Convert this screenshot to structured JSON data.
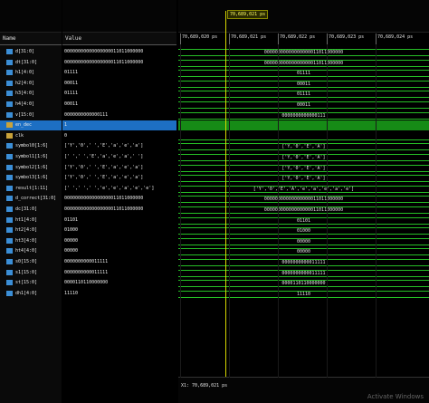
{
  "headers": {
    "name": "Name",
    "value": "Value"
  },
  "cursor": {
    "label": "70,689,021 ps"
  },
  "ruler": [
    "70,689,020 ps",
    "70,689,021 ps",
    "70,689,022 ps",
    "70,689,023 ps",
    "70,689,024 ps"
  ],
  "signals": [
    {
      "name": "d[31:0]",
      "value": "00000000000000000011011000000",
      "wave": "00000000000000000011011000000"
    },
    {
      "name": "dt[31:0]",
      "value": "00000000000000000011011000000",
      "wave": "00000000000000000011011000000"
    },
    {
      "name": "h1[4:0]",
      "value": "01111",
      "wave": "01111"
    },
    {
      "name": "h2[4:0]",
      "value": "00011",
      "wave": "00011"
    },
    {
      "name": "h3[4:0]",
      "value": "01111",
      "wave": "01111"
    },
    {
      "name": "h4[4:0]",
      "value": "00011",
      "wave": "00011"
    },
    {
      "name": "v[15:0]",
      "value": "0000000000000111",
      "wave": "0000000000000111"
    },
    {
      "name": "en_dec",
      "value": "1",
      "wave": "",
      "selected": true
    },
    {
      "name": "clk",
      "value": "0",
      "wave": ""
    },
    {
      "name": "symbol0[1:6]",
      "value": "['Y','0',' ','E','a','e','a']",
      "wave": "['Y,'0','E','A']"
    },
    {
      "name": "symbol1[1:6]",
      "value": "[' ',' ','E','a','e','a',' ']",
      "wave": "['Y,'0','E','A']"
    },
    {
      "name": "symbol2[1:6]",
      "value": "['Y','0',' ','E','a','e','a']",
      "wave": "['Y,'0','E','A']"
    },
    {
      "name": "symbol3[1:6]",
      "value": "['Y','0',' ','E','a','e','a']",
      "wave": "['Y,'0','E','A']"
    },
    {
      "name": "result[1:11]",
      "value": "[' ',' ',' ','e','e','a','e','e']",
      "wave": "['Y','0','E','A','e','a','e','a','e']"
    },
    {
      "name": "d_correct[31:0]",
      "value": "00000000000000000011011000000",
      "wave": "00000000000000000011011000000"
    },
    {
      "name": "dc[31:0]",
      "value": "00000000000000000011011000000",
      "wave": "00000000000000000011011000000"
    },
    {
      "name": "ht1[4:0]",
      "value": "01101",
      "wave": "01101"
    },
    {
      "name": "ht2[4:0]",
      "value": "01000",
      "wave": "01000"
    },
    {
      "name": "ht3[4:0]",
      "value": "00000",
      "wave": "00000"
    },
    {
      "name": "ht4[4:0]",
      "value": "00000",
      "wave": "00000"
    },
    {
      "name": "s0[15:0]",
      "value": "0000000000011111",
      "wave": "0000000000011111"
    },
    {
      "name": "s1[15:0]",
      "value": "0000000000011111",
      "wave": "0000000000011111"
    },
    {
      "name": "st[15:0]",
      "value": "0000110110000000",
      "wave": "0000110110000000"
    },
    {
      "name": "dh1[4:0]",
      "value": "11110",
      "wave": "11110"
    }
  ],
  "status": {
    "text": "X1: 70,689,021 ps"
  },
  "watermark": "Activate Windows"
}
